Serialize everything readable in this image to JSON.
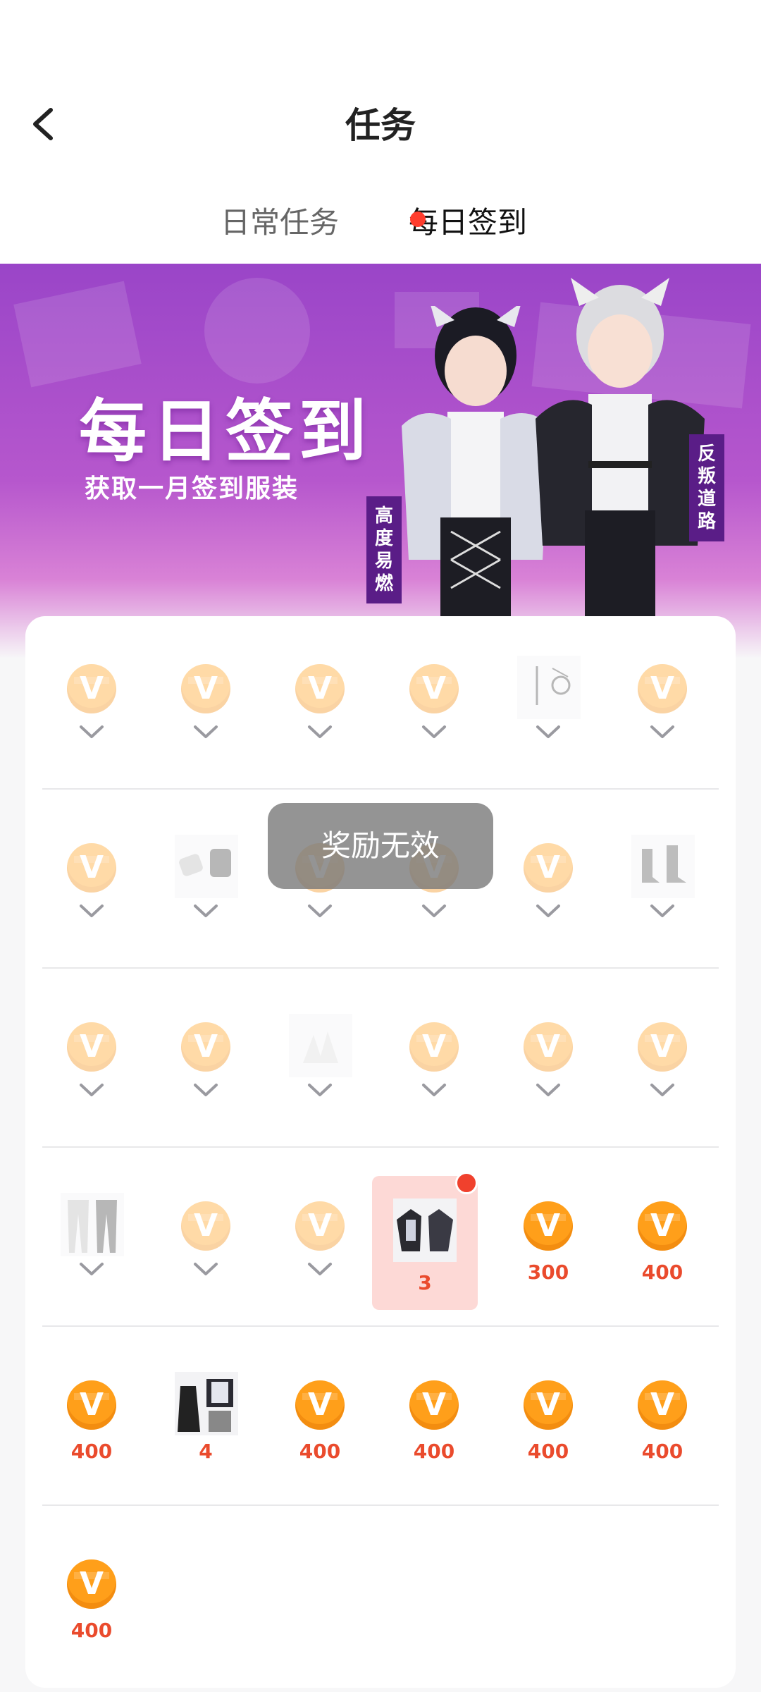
{
  "header": {
    "title": "任务",
    "back_icon": "chevron-left-icon"
  },
  "tabs": [
    {
      "label": "日常任务",
      "active": false
    },
    {
      "label": "每日签到",
      "active": true,
      "has_badge": true
    }
  ],
  "banner": {
    "title": "每日签到",
    "subtitle": "获取一月签到服装",
    "tag_left": "高度易燃",
    "tag_right": "反叛道路",
    "colors": {
      "gradient_top": "#9a45c8",
      "gradient_bottom": "#d982d6"
    }
  },
  "checkin": {
    "coin_color": "#ff9f1a",
    "amount_color": "#ea4b2d",
    "rows": [
      [
        {
          "type": "coin",
          "claimed": true
        },
        {
          "type": "coin",
          "claimed": true
        },
        {
          "type": "coin",
          "claimed": true
        },
        {
          "type": "coin",
          "claimed": true
        },
        {
          "type": "item",
          "claimed": true,
          "icon": "accessory-icon"
        },
        {
          "type": "coin",
          "claimed": true
        }
      ],
      [
        {
          "type": "coin",
          "claimed": true
        },
        {
          "type": "item",
          "claimed": true,
          "icon": "gloves-icon"
        },
        {
          "type": "coin",
          "claimed": true
        },
        {
          "type": "coin",
          "claimed": true
        },
        {
          "type": "coin",
          "claimed": true
        },
        {
          "type": "item",
          "claimed": true,
          "icon": "boots-icon"
        }
      ],
      [
        {
          "type": "coin",
          "claimed": true
        },
        {
          "type": "coin",
          "claimed": true
        },
        {
          "type": "item",
          "claimed": true,
          "icon": "hat-icon"
        },
        {
          "type": "coin",
          "claimed": true
        },
        {
          "type": "coin",
          "claimed": true
        },
        {
          "type": "coin",
          "claimed": true
        }
      ],
      [
        {
          "type": "item",
          "claimed": true,
          "icon": "pants-icon"
        },
        {
          "type": "coin",
          "claimed": true
        },
        {
          "type": "coin",
          "claimed": true
        },
        {
          "type": "item",
          "claimed": false,
          "current": true,
          "amount": "3",
          "icon": "jacket-icon"
        },
        {
          "type": "coin",
          "claimed": false,
          "amount": "300"
        },
        {
          "type": "coin",
          "claimed": false,
          "amount": "400"
        }
      ],
      [
        {
          "type": "coin",
          "claimed": false,
          "amount": "400"
        },
        {
          "type": "item",
          "claimed": false,
          "amount": "4",
          "icon": "outfit-icon"
        },
        {
          "type": "coin",
          "claimed": false,
          "amount": "400"
        },
        {
          "type": "coin",
          "claimed": false,
          "amount": "400"
        },
        {
          "type": "coin",
          "claimed": false,
          "amount": "400"
        },
        {
          "type": "coin",
          "claimed": false,
          "amount": "400"
        }
      ],
      [
        {
          "type": "coin",
          "claimed": false,
          "amount": "400"
        }
      ]
    ]
  },
  "toast": {
    "text": "奖励无效"
  }
}
